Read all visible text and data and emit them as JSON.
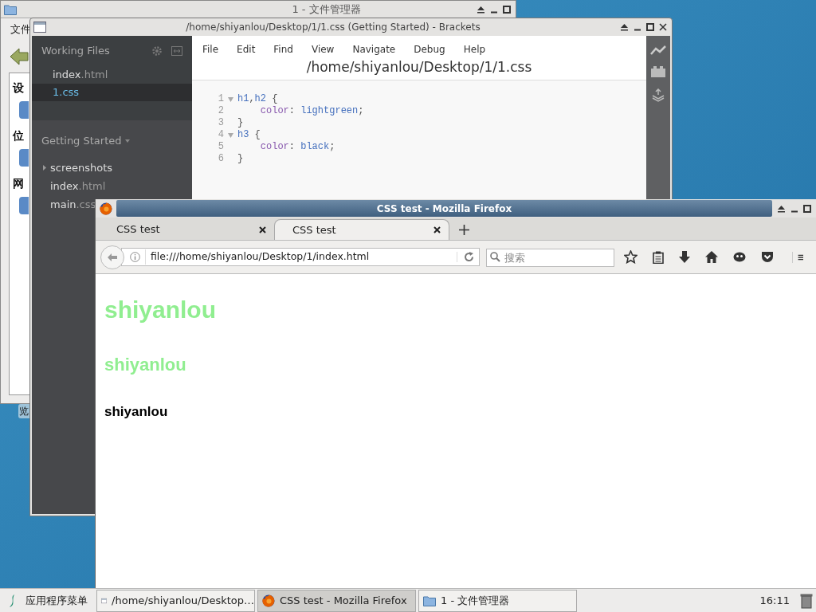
{
  "desktop": {
    "icon_label": "览"
  },
  "file_manager": {
    "title": "1 - 文件管理器",
    "menu": [
      "文件"
    ],
    "sidebar_sections": [
      "设",
      "位",
      "网"
    ]
  },
  "brackets": {
    "title": "/home/shiyanlou/Desktop/1/1.css (Getting Started) - Brackets",
    "working_files_label": "Working Files",
    "working_files": [
      {
        "name": "index",
        "ext": ".html",
        "selected": false
      },
      {
        "name": "1",
        "ext": ".css",
        "selected": true
      }
    ],
    "project": "Getting Started",
    "tree": [
      {
        "name": "screenshots",
        "kind": "folder"
      },
      {
        "name": "index",
        "ext": ".html",
        "kind": "file"
      },
      {
        "name": "main",
        "ext": ".css",
        "kind": "file"
      }
    ],
    "menu": [
      "File",
      "Edit",
      "Find",
      "View",
      "Navigate",
      "Debug",
      "Help"
    ],
    "path": "/home/shiyanlou/Desktop/1/1.css",
    "code": [
      {
        "number": "1",
        "foldable": true,
        "tokens": [
          {
            "text": "h1",
            "kind": "selector"
          },
          {
            "text": ",",
            "kind": "punct"
          },
          {
            "text": "h2",
            "kind": "selector"
          },
          {
            "text": " {",
            "kind": "punct"
          }
        ]
      },
      {
        "number": "2",
        "foldable": false,
        "tokens": [
          {
            "text": "    color",
            "kind": "property"
          },
          {
            "text": ": ",
            "kind": "punct"
          },
          {
            "text": "lightgreen",
            "kind": "value"
          },
          {
            "text": ";",
            "kind": "punct"
          }
        ]
      },
      {
        "number": "3",
        "foldable": false,
        "tokens": [
          {
            "text": "}",
            "kind": "punct"
          }
        ]
      },
      {
        "number": "4",
        "foldable": true,
        "tokens": [
          {
            "text": "h3",
            "kind": "selector"
          },
          {
            "text": " {",
            "kind": "punct"
          }
        ]
      },
      {
        "number": "5",
        "foldable": false,
        "tokens": [
          {
            "text": "    color",
            "kind": "property"
          },
          {
            "text": ": ",
            "kind": "punct"
          },
          {
            "text": "black",
            "kind": "value"
          },
          {
            "text": ";",
            "kind": "punct"
          }
        ]
      },
      {
        "number": "6",
        "foldable": false,
        "tokens": [
          {
            "text": "}",
            "kind": "punct"
          }
        ]
      }
    ]
  },
  "firefox": {
    "title": "CSS test - Mozilla Firefox",
    "tabs": [
      {
        "label": "CSS test",
        "selected": false
      },
      {
        "label": "CSS test",
        "selected": true
      }
    ],
    "url": "file:///home/shiyanlou/Desktop/1/index.html",
    "search_placeholder": "搜索",
    "page": [
      {
        "kind": "h1",
        "text": "shiyanlou",
        "color": "#90ee90"
      },
      {
        "kind": "h2",
        "text": "shiyanlou",
        "color": "#90ee90"
      },
      {
        "kind": "h3",
        "text": "shiyanlou",
        "color": "#000000"
      }
    ]
  },
  "taskbar": {
    "menu": "应用程序菜单",
    "tasks": [
      {
        "label": "/home/shiyanlou/Desktop…",
        "kind": "window",
        "selected": false
      },
      {
        "label": "CSS test - Mozilla Firefox",
        "kind": "firefox",
        "selected": true
      },
      {
        "label": "1 - 文件管理器",
        "kind": "folder",
        "selected": false
      }
    ],
    "clock": "16:11"
  }
}
